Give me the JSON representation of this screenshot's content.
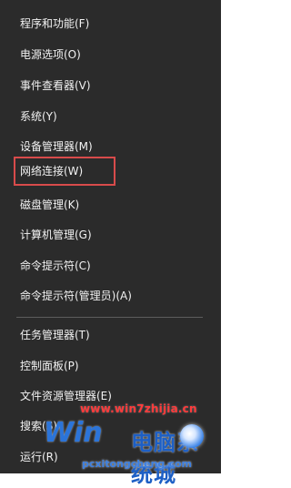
{
  "menu": {
    "items": [
      {
        "label": "程序和功能(F)"
      },
      {
        "label": "电源选项(O)"
      },
      {
        "label": "事件查看器(V)"
      },
      {
        "label": "系统(Y)"
      },
      {
        "label": "设备管理器(M)"
      },
      {
        "label": "网络连接(W)"
      },
      {
        "label": "磁盘管理(K)"
      },
      {
        "label": "计算机管理(G)"
      },
      {
        "label": "命令提示符(C)"
      },
      {
        "label": "命令提示符(管理员)(A)"
      },
      {
        "label": "任务管理器(T)"
      },
      {
        "label": "控制面板(P)"
      },
      {
        "label": "文件资源管理器(E)"
      },
      {
        "label": "搜索(S)"
      },
      {
        "label": "运行(R)"
      }
    ],
    "highlighted_item": "网络连接(W)",
    "highlight_color": "#d84b4b"
  },
  "watermark": {
    "site": "www.win7zhijia.cn",
    "brand_win": "Win",
    "brand_text": "电脑系统城",
    "sub": "pcxitongcheng.com",
    "icon": "windows-orb-icon"
  }
}
